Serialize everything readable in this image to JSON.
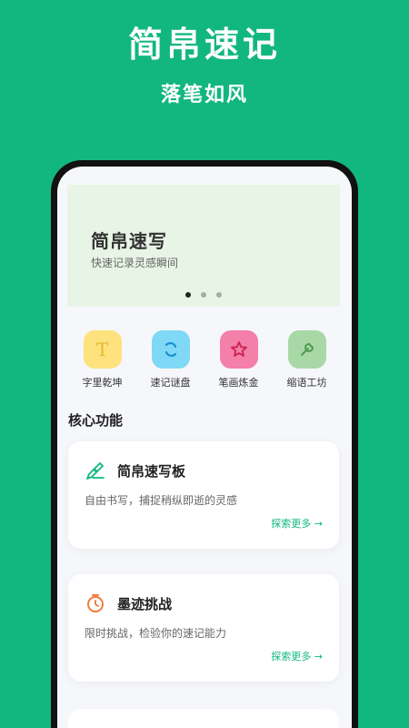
{
  "promo": {
    "title": "简帛速记",
    "subtitle": "落笔如风"
  },
  "banner": {
    "title": "简帛速写",
    "subtitle": "快速记录灵感瞬间",
    "page_count": 3,
    "active_page": 1
  },
  "quick_actions": [
    {
      "label": "字里乾坤",
      "icon": "letter-t-icon",
      "color": "#fde27e",
      "glyph": "T",
      "glyph_color": "#e9b82a"
    },
    {
      "label": "速记谜盘",
      "icon": "refresh-icon",
      "color": "#7fd8f6",
      "glyph": "⟳",
      "glyph_color": "#1a8fd1"
    },
    {
      "label": "笔画炼金",
      "icon": "star-icon",
      "color": "#f47fa8",
      "glyph": "☆",
      "glyph_color": "#c8234f"
    },
    {
      "label": "缩语工坊",
      "icon": "wrench-icon",
      "color": "#a9d8a7",
      "glyph": "🔧",
      "glyph_color": "#4a9d4d"
    }
  ],
  "section": {
    "title": "核心功能"
  },
  "cards": [
    {
      "title": "简帛速写板",
      "desc": "自由书写，捕捉稍纵即逝的灵感",
      "more": "探索更多 →",
      "icon": "pen-icon",
      "icon_color": "#12b77f"
    },
    {
      "title": "墨迹挑战",
      "desc": "限时挑战，检验你的速记能力",
      "more": "探索更多 →",
      "icon": "stopwatch-icon",
      "icon_color": "#f07a3b"
    }
  ],
  "colors": {
    "brand": "#12b77f",
    "banner_bg": "#e8f5e6"
  }
}
